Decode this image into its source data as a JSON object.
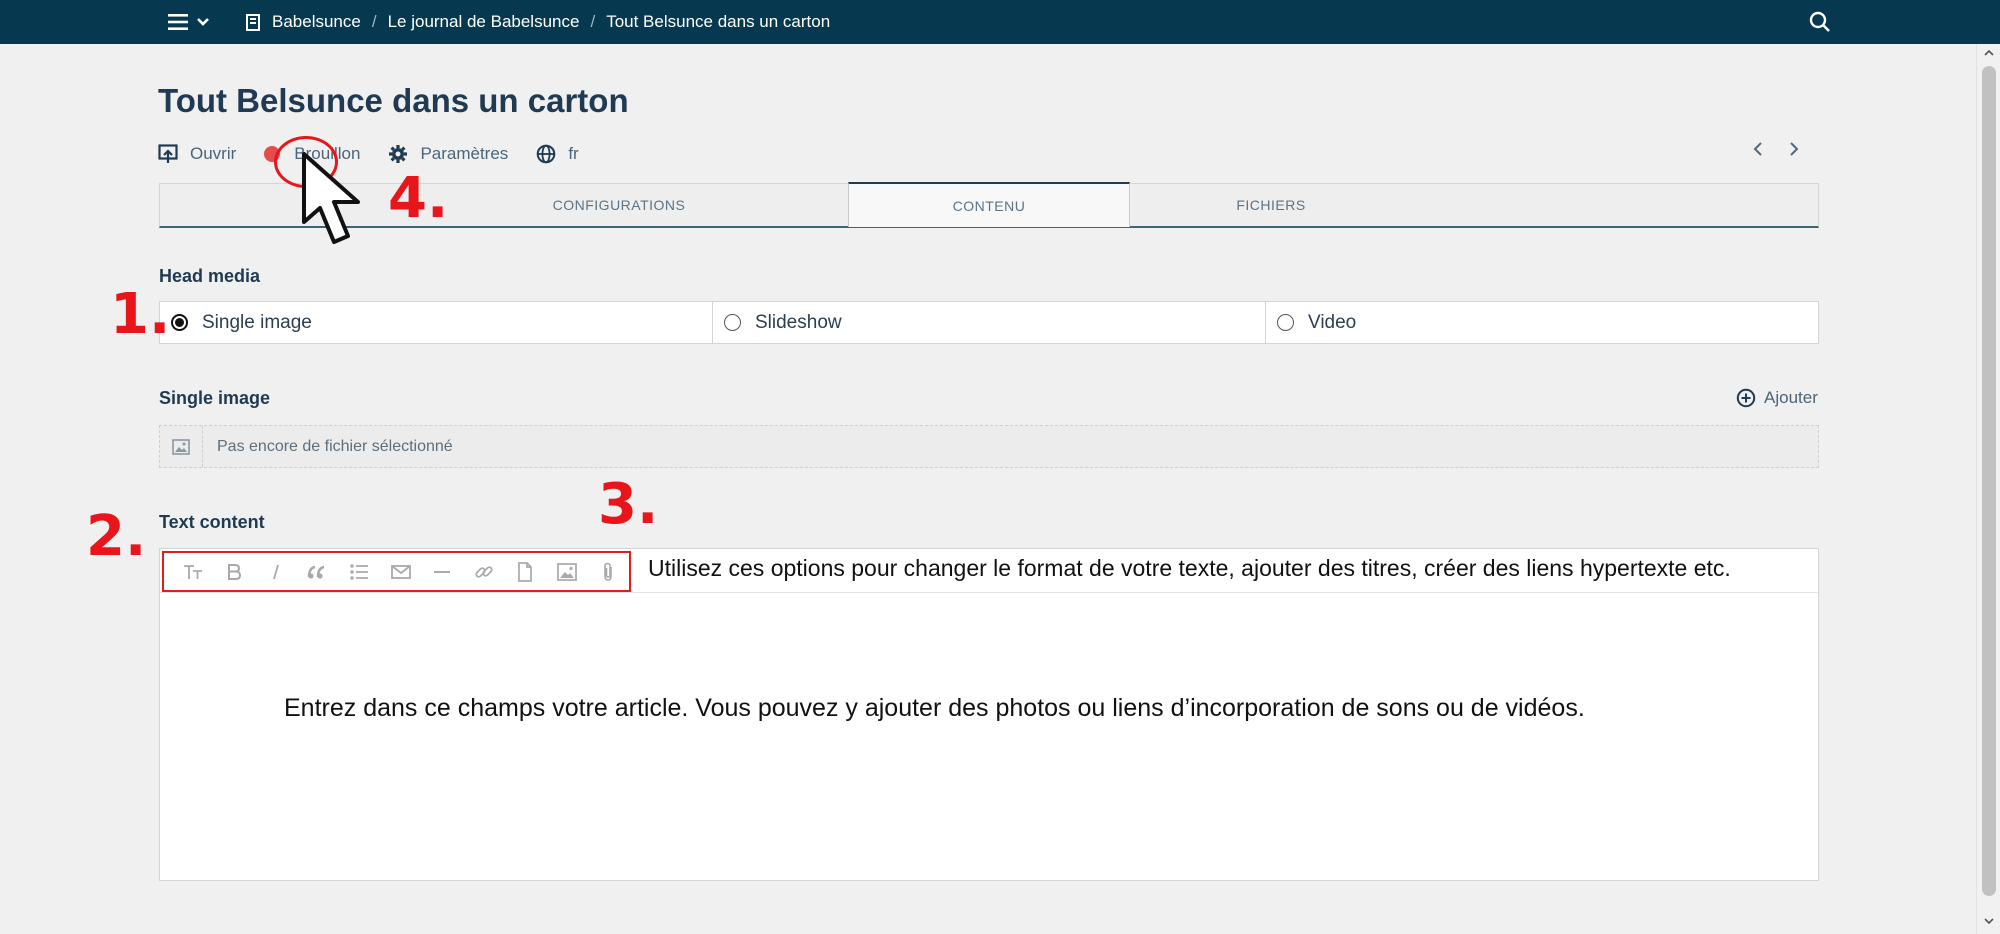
{
  "topbar": {
    "menu_icon": "hamburger-icon",
    "breadcrumbs": [
      "Babelsunce",
      "Le journal de Babelsunce",
      "Tout Belsunce dans un carton"
    ],
    "separator": "/",
    "search_icon": "search-icon"
  },
  "page": {
    "title": "Tout Belsunce dans un carton",
    "actions": {
      "open": "Ouvrir",
      "status": "Brouillon",
      "settings": "Paramètres",
      "language": "fr"
    }
  },
  "tabs": [
    {
      "label": "CONFIGURATIONS",
      "active": false
    },
    {
      "label": "CONTENU",
      "active": true
    },
    {
      "label": "FICHIERS",
      "active": false
    }
  ],
  "head_media": {
    "label": "Head media",
    "options": [
      {
        "label": "Single image",
        "checked": true
      },
      {
        "label": "Slideshow",
        "checked": false
      },
      {
        "label": "Video",
        "checked": false
      }
    ]
  },
  "single_image": {
    "label": "Single image",
    "add_label": "Ajouter",
    "placeholder": "Pas encore de fichier sélectionné"
  },
  "text_content": {
    "label": "Text content",
    "toolbar_icons": [
      "text-size-icon",
      "bold-icon",
      "italic-icon",
      "quote-icon",
      "bullet-list-icon",
      "email-icon",
      "horizontal-rule-icon",
      "link-icon",
      "file-icon",
      "image-icon",
      "attachment-icon"
    ],
    "toolbar_hint": "Utilisez ces options pour changer le format de votre texte, ajouter des titres, créer des liens hypertexte etc.",
    "body_hint": "Entrez dans ce champs votre article. Vous pouvez y ajouter des photos ou liens d’incorporation de sons ou de vidéos."
  },
  "annotations": {
    "n1": "1.",
    "n2": "2.",
    "n3": "3.",
    "n4": "4."
  },
  "colors": {
    "topbar": "#06394f",
    "annotation": "#e8151b",
    "status_dot": "#e84b4b"
  }
}
